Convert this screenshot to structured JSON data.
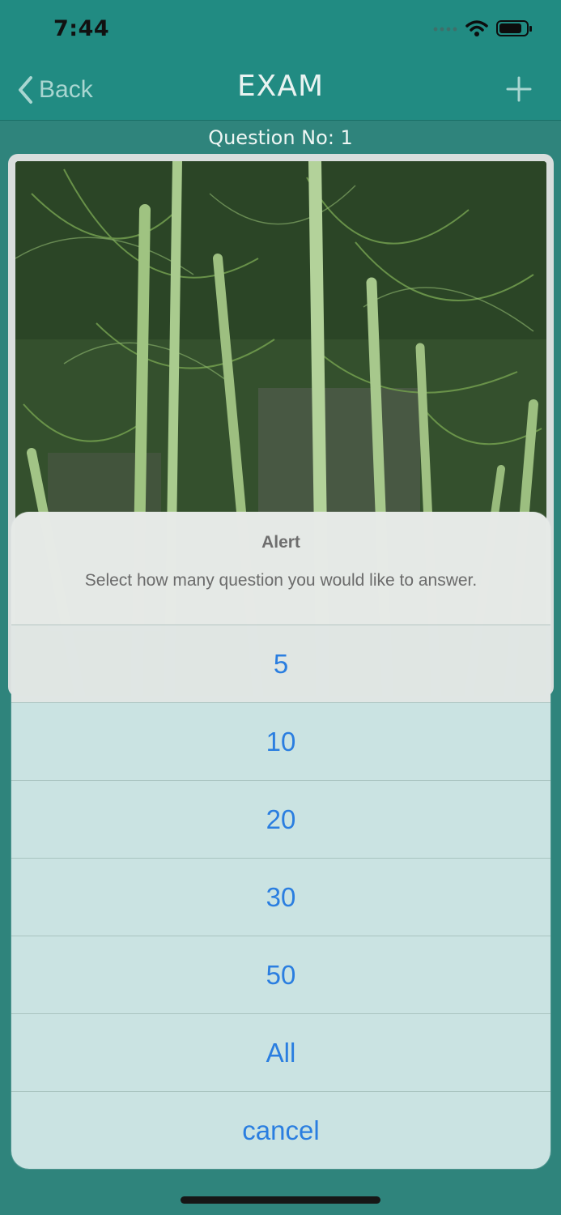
{
  "status_bar": {
    "time": "7:44"
  },
  "nav": {
    "back_label": "Back",
    "title": "EXAM",
    "add_icon": "plus-icon"
  },
  "question": {
    "number_label": "Question No: 1"
  },
  "alert": {
    "title": "Alert",
    "message": "Select how many question you would like to answer.",
    "options": [
      "5",
      "10",
      "20",
      "30",
      "50",
      "All",
      "cancel"
    ]
  },
  "colors": {
    "nav_background": "#218b82",
    "page_background": "#2f847c",
    "alert_action_text": "#2a7ee0"
  }
}
